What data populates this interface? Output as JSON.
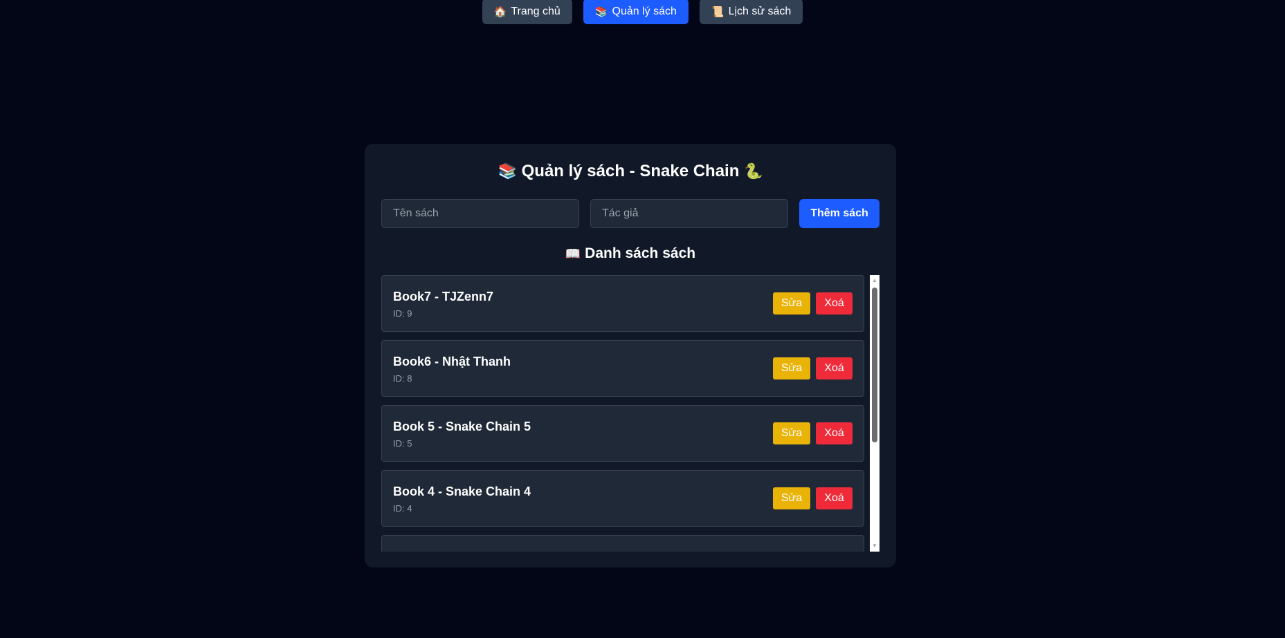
{
  "nav": {
    "items": [
      {
        "icon": "house-icon",
        "emoji": "🏠",
        "label": "Trang chủ",
        "active": false
      },
      {
        "icon": "books-icon",
        "emoji": "📚",
        "label": "Quản lý sách",
        "active": true
      },
      {
        "icon": "scroll-icon",
        "emoji": "📜",
        "label": "Lịch sử sách",
        "active": false
      }
    ]
  },
  "panel": {
    "title_emoji_left": "📚",
    "title": "Quản lý sách - Snake Chain",
    "title_emoji_right": "🐍",
    "form": {
      "name_placeholder": "Tên sách",
      "name_value": "",
      "author_placeholder": "Tác giả",
      "author_value": "",
      "add_label": "Thêm sách"
    },
    "list_heading_emoji": "📖",
    "list_heading": "Danh sách sách",
    "books": [
      {
        "title": "Book7 - TJZenn7",
        "id": "ID: 9"
      },
      {
        "title": "Book6 - Nhật Thanh",
        "id": "ID: 8"
      },
      {
        "title": "Book 5 - Snake Chain 5",
        "id": "ID: 5"
      },
      {
        "title": "Book 4 - Snake Chain 4",
        "id": "ID: 4"
      },
      {
        "title": "",
        "id": ""
      }
    ],
    "edit_label": "Sửa",
    "delete_label": "Xoá"
  },
  "colors": {
    "background": "#020617",
    "panel": "#111827",
    "accent": "#1d5cff",
    "edit": "#eab308",
    "delete": "#ef2b3a"
  }
}
